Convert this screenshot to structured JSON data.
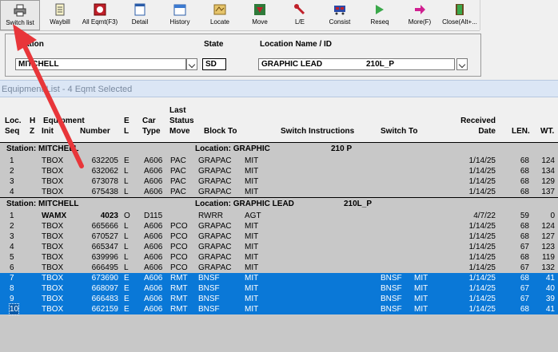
{
  "toolbar": {
    "buttons": [
      {
        "label": "Switch list",
        "icon": "printer-icon"
      },
      {
        "label": "Waybill",
        "icon": "document-icon"
      },
      {
        "label": "All Eqmt(F3)",
        "icon": "equipment-icon"
      },
      {
        "label": "Detail",
        "icon": "window-icon"
      },
      {
        "label": "History",
        "icon": "calendar-icon"
      },
      {
        "label": "Locate",
        "icon": "map-icon"
      },
      {
        "label": "Move",
        "icon": "move-icon"
      },
      {
        "label": "L/E",
        "icon": "wrench-icon"
      },
      {
        "label": "Consist",
        "icon": "train-icon"
      },
      {
        "label": "Reseq",
        "icon": "resequence-icon"
      },
      {
        "label": "More(F)",
        "icon": "arrow-right-icon"
      },
      {
        "label": "Close(Alt+...",
        "icon": "exit-door-icon"
      }
    ]
  },
  "filters": {
    "station_label": "Station",
    "station_value": "MITCHELL",
    "state_label": "State",
    "state_value": "SD",
    "location_label": "Location Name / ID",
    "location_value": "GRAPHIC LEAD",
    "location_id": "210L_P"
  },
  "list_title": "Equipment List - 4 Eqmt Selected",
  "headers": {
    "loc_seq": [
      "Loc.",
      "Seq"
    ],
    "hz": [
      "H",
      "Z"
    ],
    "equipment": [
      "Equipment",
      "Init",
      "Number"
    ],
    "el": [
      "E",
      "L"
    ],
    "car_type": [
      "Car",
      "Type"
    ],
    "last_status": [
      "Last",
      "Status",
      "Move"
    ],
    "block_to": "Block To",
    "switch_instr": "Switch Instructions",
    "switch_to": "Switch To",
    "received": [
      "Received",
      "Date"
    ],
    "len": "LEN.",
    "wt": "WT."
  },
  "groups": [
    {
      "station": "Station: MITCHELL",
      "location": "Location: GRAPHIC",
      "loc_id": "210  P",
      "rows": [
        {
          "seq": "1",
          "init": "TBOX",
          "num": "632205",
          "el": "E",
          "type": "A606",
          "move": "PAC",
          "block": "GRAPAC",
          "instr": "MIT",
          "switch_to": "",
          "switch_instr2": "",
          "date": "1/14/25",
          "len": "68",
          "wt": "124",
          "sel": false
        },
        {
          "seq": "2",
          "init": "TBOX",
          "num": "632062",
          "el": "L",
          "type": "A606",
          "move": "PAC",
          "block": "GRAPAC",
          "instr": "MIT",
          "switch_to": "",
          "switch_instr2": "",
          "date": "1/14/25",
          "len": "68",
          "wt": "134",
          "sel": false
        },
        {
          "seq": "3",
          "init": "TBOX",
          "num": "673078",
          "el": "L",
          "type": "A606",
          "move": "PAC",
          "block": "GRAPAC",
          "instr": "MIT",
          "switch_to": "",
          "switch_instr2": "",
          "date": "1/14/25",
          "len": "68",
          "wt": "129",
          "sel": false
        },
        {
          "seq": "4",
          "init": "TBOX",
          "num": "675438",
          "el": "L",
          "type": "A606",
          "move": "PAC",
          "block": "GRAPAC",
          "instr": "MIT",
          "switch_to": "",
          "switch_instr2": "",
          "date": "1/14/25",
          "len": "68",
          "wt": "137",
          "sel": false
        }
      ]
    },
    {
      "station": "Station: MITCHELL",
      "location": "Location: GRAPHIC LEAD",
      "loc_id": "210L_P",
      "rows": [
        {
          "seq": "1",
          "init": "WAMX",
          "num": "4023",
          "el": "O",
          "type": "D115",
          "move": "",
          "block": "RWRR",
          "instr": "AGT",
          "switch_to": "",
          "switch_instr2": "",
          "date": "4/7/22",
          "len": "59",
          "wt": "0",
          "sel": false,
          "bold": true
        },
        {
          "seq": "2",
          "init": "TBOX",
          "num": "665666",
          "el": "L",
          "type": "A606",
          "move": "PCO",
          "block": "GRAPAC",
          "instr": "MIT",
          "switch_to": "",
          "switch_instr2": "",
          "date": "1/14/25",
          "len": "68",
          "wt": "124",
          "sel": false
        },
        {
          "seq": "3",
          "init": "TBOX",
          "num": "670527",
          "el": "L",
          "type": "A606",
          "move": "PCO",
          "block": "GRAPAC",
          "instr": "MIT",
          "switch_to": "",
          "switch_instr2": "",
          "date": "1/14/25",
          "len": "68",
          "wt": "127",
          "sel": false
        },
        {
          "seq": "4",
          "init": "TBOX",
          "num": "665347",
          "el": "L",
          "type": "A606",
          "move": "PCO",
          "block": "GRAPAC",
          "instr": "MIT",
          "switch_to": "",
          "switch_instr2": "",
          "date": "1/14/25",
          "len": "67",
          "wt": "123",
          "sel": false
        },
        {
          "seq": "5",
          "init": "TBOX",
          "num": "639996",
          "el": "L",
          "type": "A606",
          "move": "PCO",
          "block": "GRAPAC",
          "instr": "MIT",
          "switch_to": "",
          "switch_instr2": "",
          "date": "1/14/25",
          "len": "68",
          "wt": "119",
          "sel": false
        },
        {
          "seq": "6",
          "init": "TBOX",
          "num": "666495",
          "el": "L",
          "type": "A606",
          "move": "PCO",
          "block": "GRAPAC",
          "instr": "MIT",
          "switch_to": "",
          "switch_instr2": "",
          "date": "1/14/25",
          "len": "67",
          "wt": "132",
          "sel": false
        },
        {
          "seq": "7",
          "init": "TBOX",
          "num": "673690",
          "el": "E",
          "type": "A606",
          "move": "RMT",
          "block": "BNSF",
          "instr": "MIT",
          "switch_to": "BNSF",
          "switch_instr2": "MIT",
          "date": "1/14/25",
          "len": "68",
          "wt": "41",
          "sel": true
        },
        {
          "seq": "8",
          "init": "TBOX",
          "num": "668097",
          "el": "E",
          "type": "A606",
          "move": "RMT",
          "block": "BNSF",
          "instr": "MIT",
          "switch_to": "BNSF",
          "switch_instr2": "MIT",
          "date": "1/14/25",
          "len": "67",
          "wt": "40",
          "sel": true
        },
        {
          "seq": "9",
          "init": "TBOX",
          "num": "666483",
          "el": "E",
          "type": "A606",
          "move": "RMT",
          "block": "BNSF",
          "instr": "MIT",
          "switch_to": "BNSF",
          "switch_instr2": "MIT",
          "date": "1/14/25",
          "len": "67",
          "wt": "39",
          "sel": true
        },
        {
          "seq": "10",
          "init": "TBOX",
          "num": "662159",
          "el": "E",
          "type": "A606",
          "move": "RMT",
          "block": "BNSF",
          "instr": "MIT",
          "switch_to": "BNSF",
          "switch_instr2": "MIT",
          "date": "1/14/25",
          "len": "68",
          "wt": "41",
          "sel": true,
          "focus": true
        }
      ]
    }
  ],
  "colors": {
    "selection": "#0a78d7",
    "arrow": "#e8363a"
  }
}
